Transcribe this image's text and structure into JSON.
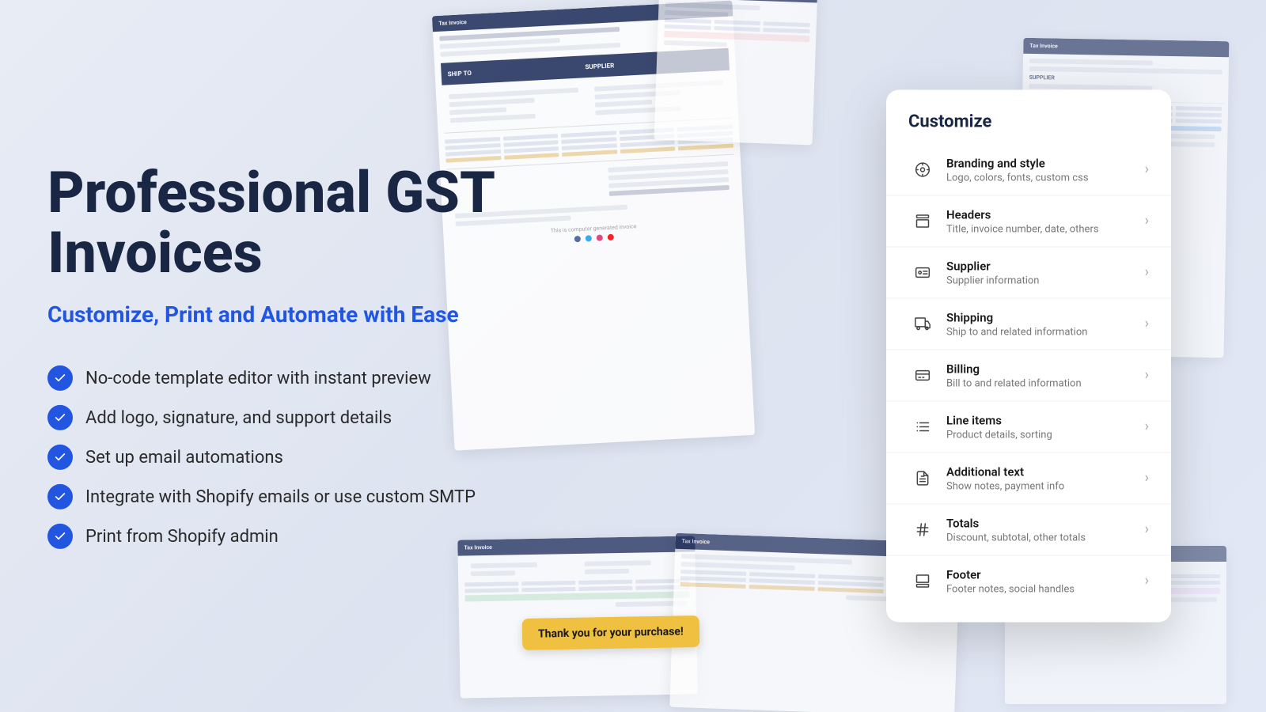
{
  "page": {
    "background": "#e8ecf5"
  },
  "hero": {
    "title_line1": "Professional GST",
    "title_line2": "Invoices",
    "subtitle": "Customize, Print and Automate with Ease",
    "features": [
      {
        "id": "f1",
        "text": "No-code template editor with instant preview"
      },
      {
        "id": "f2",
        "text": "Add logo, signature, and support details"
      },
      {
        "id": "f3",
        "text": "Set up email automations"
      },
      {
        "id": "f4",
        "text": "Integrate with Shopify emails or use custom SMTP"
      },
      {
        "id": "f5",
        "text": "Print from Shopify admin"
      }
    ]
  },
  "customize_panel": {
    "title": "Customize",
    "items": [
      {
        "id": "branding",
        "title": "Branding and style",
        "desc": "Logo, colors, fonts, custom css",
        "icon": "palette"
      },
      {
        "id": "headers",
        "title": "Headers",
        "desc": "Title, invoice number, date, others",
        "icon": "layout"
      },
      {
        "id": "supplier",
        "title": "Supplier",
        "desc": "Supplier information",
        "icon": "id-card"
      },
      {
        "id": "shipping",
        "title": "Shipping",
        "desc": "Ship to and related information",
        "icon": "truck"
      },
      {
        "id": "billing",
        "title": "Billing",
        "desc": "Bill to and related information",
        "icon": "credit-card"
      },
      {
        "id": "line-items",
        "title": "Line items",
        "desc": "Product details, sorting",
        "icon": "list"
      },
      {
        "id": "additional-text",
        "title": "Additional text",
        "desc": "Show notes, payment info",
        "icon": "file-text"
      },
      {
        "id": "totals",
        "title": "Totals",
        "desc": "Discount, subtotal, other totals",
        "icon": "hash"
      },
      {
        "id": "footer",
        "title": "Footer",
        "desc": "Footer notes, social handles",
        "icon": "footer"
      }
    ]
  },
  "thank_you": "Thank you for your purchase!"
}
